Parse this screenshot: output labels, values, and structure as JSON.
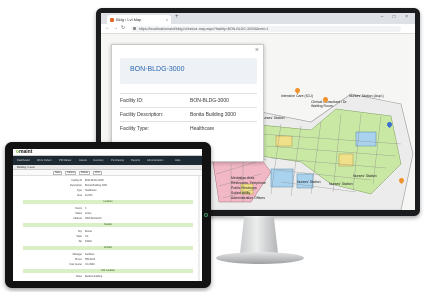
{
  "browser": {
    "tab_title": "Bldg / Lvl Map",
    "tab_close": "×",
    "new_tab": "+",
    "window_controls": "– □ ×",
    "url": "https://localhost/omaint/bldg-lvl/indoor-map.aspx?facility=BON-BLDG-3000&level=1",
    "nav_back": "←",
    "nav_forward": "→",
    "nav_reload": "↻"
  },
  "popup": {
    "close": "×",
    "title": "BON-BLDG-3000",
    "rows": [
      {
        "key": "Facility ID:",
        "value": "BON-BLDG-3000"
      },
      {
        "key": "Facility Description:",
        "value": "Bonita Building 3000"
      },
      {
        "key": "Facility Type:",
        "value": "Healthcare"
      }
    ]
  },
  "map": {
    "labels": [
      "Intensive Care (ICU)",
      "Clinical Consultant / Dr. Waiting Room",
      "Nurses' Station (Aspl.)",
      "Nurses' Station",
      "Mediation Area",
      "Restrooms, Telephone",
      "Public Restroom",
      "Soiled Utility",
      "Administration Offices",
      "Nurses' Station",
      "Nurses' Station",
      "Nurses' Station"
    ],
    "colors": {
      "wing_green": "#c9e8a4",
      "wing_pink": "#f2b8c6",
      "wing_blue": "#a9d2ee",
      "wing_yellow": "#f1e08a",
      "pin_orange": "#f0922b",
      "pin_blue": "#3a6fd0"
    }
  },
  "app": {
    "logo_prefix": "o",
    "logo_main": "maint",
    "nav_items": [
      "Dashboard",
      "Work Orders",
      "PM Master",
      "Assets",
      "Inventory",
      "Purchasing",
      "Reports",
      "Administration",
      "Help"
    ],
    "subheader": "Building / Level",
    "toolbar": [
      "Save",
      "Cancel",
      "Delete",
      "Print"
    ],
    "form_rows": [
      {
        "key": "Facility ID",
        "value": "BON-BLDG-3000"
      },
      {
        "key": "Description",
        "value": "Bonita Building 3000"
      },
      {
        "key": "Type",
        "value": "Healthcare"
      },
      {
        "key": "Area",
        "value": "42,000"
      },
      {
        "key": "Floors",
        "value": "3"
      },
      {
        "key": "Status",
        "value": "Active"
      },
      {
        "key": "Address",
        "value": "3000 Bonita Rd"
      },
      {
        "key": "City",
        "value": "Bonita"
      },
      {
        "key": "State",
        "value": "CA"
      },
      {
        "key": "Zip",
        "value": "91902"
      },
      {
        "key": "Manager",
        "value": "Facilities"
      },
      {
        "key": "Phone",
        "value": "555-0100"
      },
      {
        "key": "Cost Center",
        "value": "CC-3000"
      },
      {
        "key": "Notes",
        "value": "Medical building"
      }
    ],
    "sections": [
      "Location",
      "Details",
      "Contact",
      "GIS Location"
    ]
  }
}
